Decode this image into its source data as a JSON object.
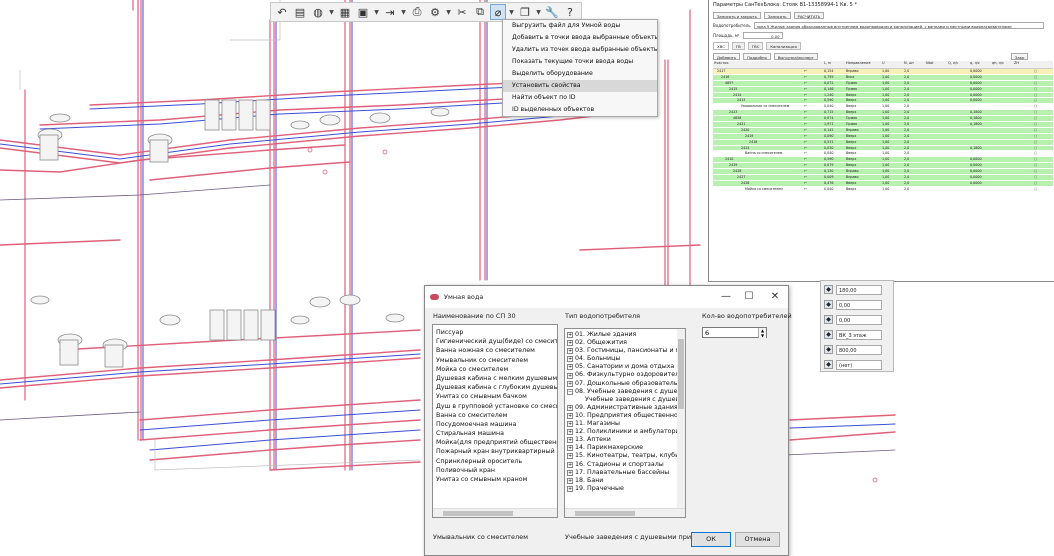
{
  "toolbar": {
    "icons": [
      "undo-icon",
      "folder-icon",
      "globe-icon",
      "layers-icon",
      "save-icon",
      "export-icon",
      "print-icon",
      "settings-icon",
      "cut-icon",
      "copy-icon",
      "smart-water-icon",
      "window-icon",
      "wrench-icon",
      "help-icon"
    ],
    "help_glyph": "?"
  },
  "context_menu": {
    "items": [
      "Выгрузить файл для Умной воды",
      "Добавить в точки ввода выбранные объекты",
      "Удалить из точек ввода выбранные объекты",
      "Показать текущие точки ввода воды",
      "Выделить оборудование",
      "Установить свойства",
      "Найти объект по ID",
      "ID выделенных объектов"
    ],
    "highlighted_index": 5
  },
  "params_panel": {
    "title": "Параметры СанТехБлока: Стояк В1-13358994-1 Кв. 5 *",
    "btn_save_close": "Записать и закрыть",
    "btn_save": "Записать",
    "btn_calc": "РАСЧИТАТЬ",
    "consumer_label": "Водопотребитель",
    "consumer_value": "зона 5 Жилые здания оборудованные внутренним водопроводом и канализацией, с ваннами и местными водонагревателями",
    "area_label": "Площадь, м²",
    "area_value": "0,00",
    "tabs": [
      "ХВС",
      "ГВ",
      "ГВС",
      "Канализация"
    ],
    "sub_add": "Добавить",
    "sub_detail": "Подробно",
    "sub_export": "Выгрузка/экспорт",
    "sub_close": "Закр",
    "columns": [
      "Участок",
      "",
      "L, м",
      "Направление",
      "U",
      "N, шт",
      "Ntot",
      "Q, л/с",
      "q, л/с",
      "qh, л/с",
      "ZH",
      ""
    ],
    "rows": [
      {
        "name": "2417",
        "l": "0,154",
        "dir": "Вправо",
        "u": "1,00",
        "n": "2,0",
        "q": "0,0000",
        "style": "yellow",
        "indent": 1
      },
      {
        "name": "2416",
        "l": "0,759",
        "dir": "Вниз",
        "u": "1,00",
        "n": "2,0",
        "q": "0,0000",
        "style": "green",
        "indent": 2
      },
      {
        "name": "4857",
        "l": "0,072",
        "dir": "Прямо",
        "u": "1,00",
        "n": "2,0",
        "q": "0,0000",
        "style": "green",
        "indent": 3
      },
      {
        "name": "2415",
        "l": "0,146",
        "dir": "Прямо",
        "u": "1,00",
        "n": "2,0",
        "q": "0,0000",
        "style": "green",
        "indent": 4
      },
      {
        "name": "2414",
        "l": "1,240",
        "dir": "Вверх",
        "u": "1,00",
        "n": "2,0",
        "q": "0,0000",
        "style": "green",
        "indent": 5
      },
      {
        "name": "2413",
        "l": "0,590",
        "dir": "Вверх",
        "u": "1,00",
        "n": "2,0",
        "q": "0,0000",
        "style": "green",
        "indent": 6
      },
      {
        "name": "Умывальник со смесителем",
        "l": "0,040",
        "dir": "Вверх",
        "u": "1,00",
        "n": "2,0",
        "q": "",
        "style": "white",
        "indent": 7
      },
      {
        "name": "2423",
        "l": "0,715",
        "dir": "Вверх",
        "u": "1,00",
        "n": "2,0",
        "q": "0,1800",
        "style": "green",
        "indent": 4
      },
      {
        "name": "4858",
        "l": "0,074",
        "dir": "Прямо",
        "u": "1,00",
        "n": "2,0",
        "q": "0,1800",
        "style": "green",
        "indent": 5
      },
      {
        "name": "2421",
        "l": "1,971",
        "dir": "Прямо",
        "u": "1,00",
        "n": "2,0",
        "q": "0,1800",
        "style": "green",
        "indent": 6
      },
      {
        "name": "2420",
        "l": "0,142",
        "dir": "Вправо",
        "u": "1,00",
        "n": "2,0",
        "q": "",
        "style": "green",
        "indent": 7
      },
      {
        "name": "2419",
        "l": "0,090",
        "dir": "Вверх",
        "u": "1,00",
        "n": "2,0",
        "q": "",
        "style": "green",
        "indent": 8
      },
      {
        "name": "2418",
        "l": "0,531",
        "dir": "Вверх",
        "u": "1,00",
        "n": "2,0",
        "q": "",
        "style": "green",
        "indent": 9
      },
      {
        "name": "2424",
        "l": "0,030",
        "dir": "Вверх",
        "u": "1,00",
        "n": "2,0",
        "q": "0,1800",
        "style": "green",
        "indent": 7
      },
      {
        "name": "Ванна со смесителем",
        "l": "0,040",
        "dir": "Вверх",
        "u": "1,00",
        "n": "2,0",
        "q": "",
        "style": "white",
        "indent": 8
      },
      {
        "name": "2410",
        "l": "0,590",
        "dir": "Вверх",
        "u": "1,00",
        "n": "2,0",
        "q": "0,0000",
        "style": "green",
        "indent": 3
      },
      {
        "name": "2429",
        "l": "0,079",
        "dir": "Вверх",
        "u": "1,00",
        "n": "2,0",
        "q": "0,0000",
        "style": "green",
        "indent": 4
      },
      {
        "name": "2428",
        "l": "0,130",
        "dir": "Вправо",
        "u": "1,00",
        "n": "2,0",
        "q": "0,0000",
        "style": "green",
        "indent": 5
      },
      {
        "name": "2427",
        "l": "0,009",
        "dir": "Вправо",
        "u": "1,00",
        "n": "2,0",
        "q": "0,0000",
        "style": "green",
        "indent": 6
      },
      {
        "name": "2426",
        "l": "0,476",
        "dir": "Вверх",
        "u": "1,00",
        "n": "2,0",
        "q": "0,0000",
        "style": "green",
        "indent": 7
      },
      {
        "name": "Мойка со смесителем",
        "l": "0,040",
        "dir": "Вверх",
        "u": "1,00",
        "n": "2,0",
        "q": "",
        "style": "white",
        "indent": 8
      }
    ]
  },
  "props_panel": {
    "rows": [
      {
        "icon": "angle-icon",
        "value": "180,00"
      },
      {
        "icon": "offset-x-icon",
        "value": "0,00"
      },
      {
        "icon": "offset-y-icon",
        "value": "0,00"
      },
      {
        "icon": "level-icon",
        "value": "ВК_3 этаж"
      },
      {
        "icon": "height-icon",
        "value": "800,00"
      },
      {
        "icon": "type-icon",
        "value": "(нет)"
      }
    ],
    "unit": "мм"
  },
  "dialog": {
    "title": "Умная вода",
    "col1_label": "Наименование по СП 30",
    "col2_label": "Тип водопотребителя",
    "col3_label": "Кол-во водопотребителей",
    "count_value": "6",
    "fixtures": [
      "Писсуар",
      "Гигиенический душ(биде) со смесителем",
      "Ванна ножная со смесителем",
      "Умывальник со смесителем",
      "Мойка со смесителем",
      "Душевая кабина с мелким душевым поддоном",
      "Душевая кабина с глубоким душевым поддоном",
      "Унитаз со смывным бачком",
      "Душ в групповой установке со смесителем",
      "Ванна со смесителем",
      "Посудомоечная машина",
      "Стиральная машина",
      "Мойка(для предприятий общественного питания)",
      "Пожарный кран внутриквартирный",
      "Спринклерный ороситель",
      "Поливочный кран",
      "Унитаз со смывным краном"
    ],
    "types": [
      {
        "label": "01. Жилые здания",
        "expanded": false,
        "child": false
      },
      {
        "label": "02. Общежития",
        "expanded": false,
        "child": false
      },
      {
        "label": "03. Гостиницы, пансионаты и мотели",
        "expanded": false,
        "child": false
      },
      {
        "label": "04. Больницы",
        "expanded": false,
        "child": false
      },
      {
        "label": "05. Санатории и дома отдыха",
        "expanded": false,
        "child": false
      },
      {
        "label": "06. Физкультурно оздоровительные учреждения",
        "expanded": false,
        "child": false
      },
      {
        "label": "07. Дошкольные образовательные учреждения",
        "expanded": false,
        "child": false
      },
      {
        "label": "08. Учебные заведения с душевыми",
        "expanded": true,
        "child": false
      },
      {
        "label": "Учебные заведения с душевыми",
        "expanded": false,
        "child": true
      },
      {
        "label": "09. Административные здания",
        "expanded": false,
        "child": false
      },
      {
        "label": "10. Предприятия общественного питания",
        "expanded": false,
        "child": false
      },
      {
        "label": "11. Магазины",
        "expanded": false,
        "child": false
      },
      {
        "label": "12. Поликлиники и амбулатории",
        "expanded": false,
        "child": false
      },
      {
        "label": "13. Аптеки",
        "expanded": false,
        "child": false
      },
      {
        "label": "14. Парикмахерские",
        "expanded": false,
        "child": false
      },
      {
        "label": "15. Кинотеатры, театры, клубы и досуговые учреждения",
        "expanded": false,
        "child": false
      },
      {
        "label": "16. Стадионы и спортзалы",
        "expanded": false,
        "child": false
      },
      {
        "label": "17. Плавательные бассейны",
        "expanded": false,
        "child": false
      },
      {
        "label": "18. Бани",
        "expanded": false,
        "child": false
      },
      {
        "label": "19. Прачечные",
        "expanded": false,
        "child": false
      }
    ],
    "selected_fixture": "Умывальник со смесителем",
    "selected_type": "Учебные заведения с душевыми при лико...",
    "ok_label": "ОК",
    "cancel_label": "Отмена",
    "minimize": "—",
    "maximize": "☐",
    "close": "✕",
    "plus": "+",
    "minus": "−"
  },
  "colors": {
    "pipe_red": "#e0607a",
    "pipe_blue": "#3a4fd8",
    "pipe_dark": "#6a5a80",
    "row_green": "#b8f0b0",
    "row_yellow": "#f7f0b8",
    "menu_highlight": "#d8d8d8"
  }
}
